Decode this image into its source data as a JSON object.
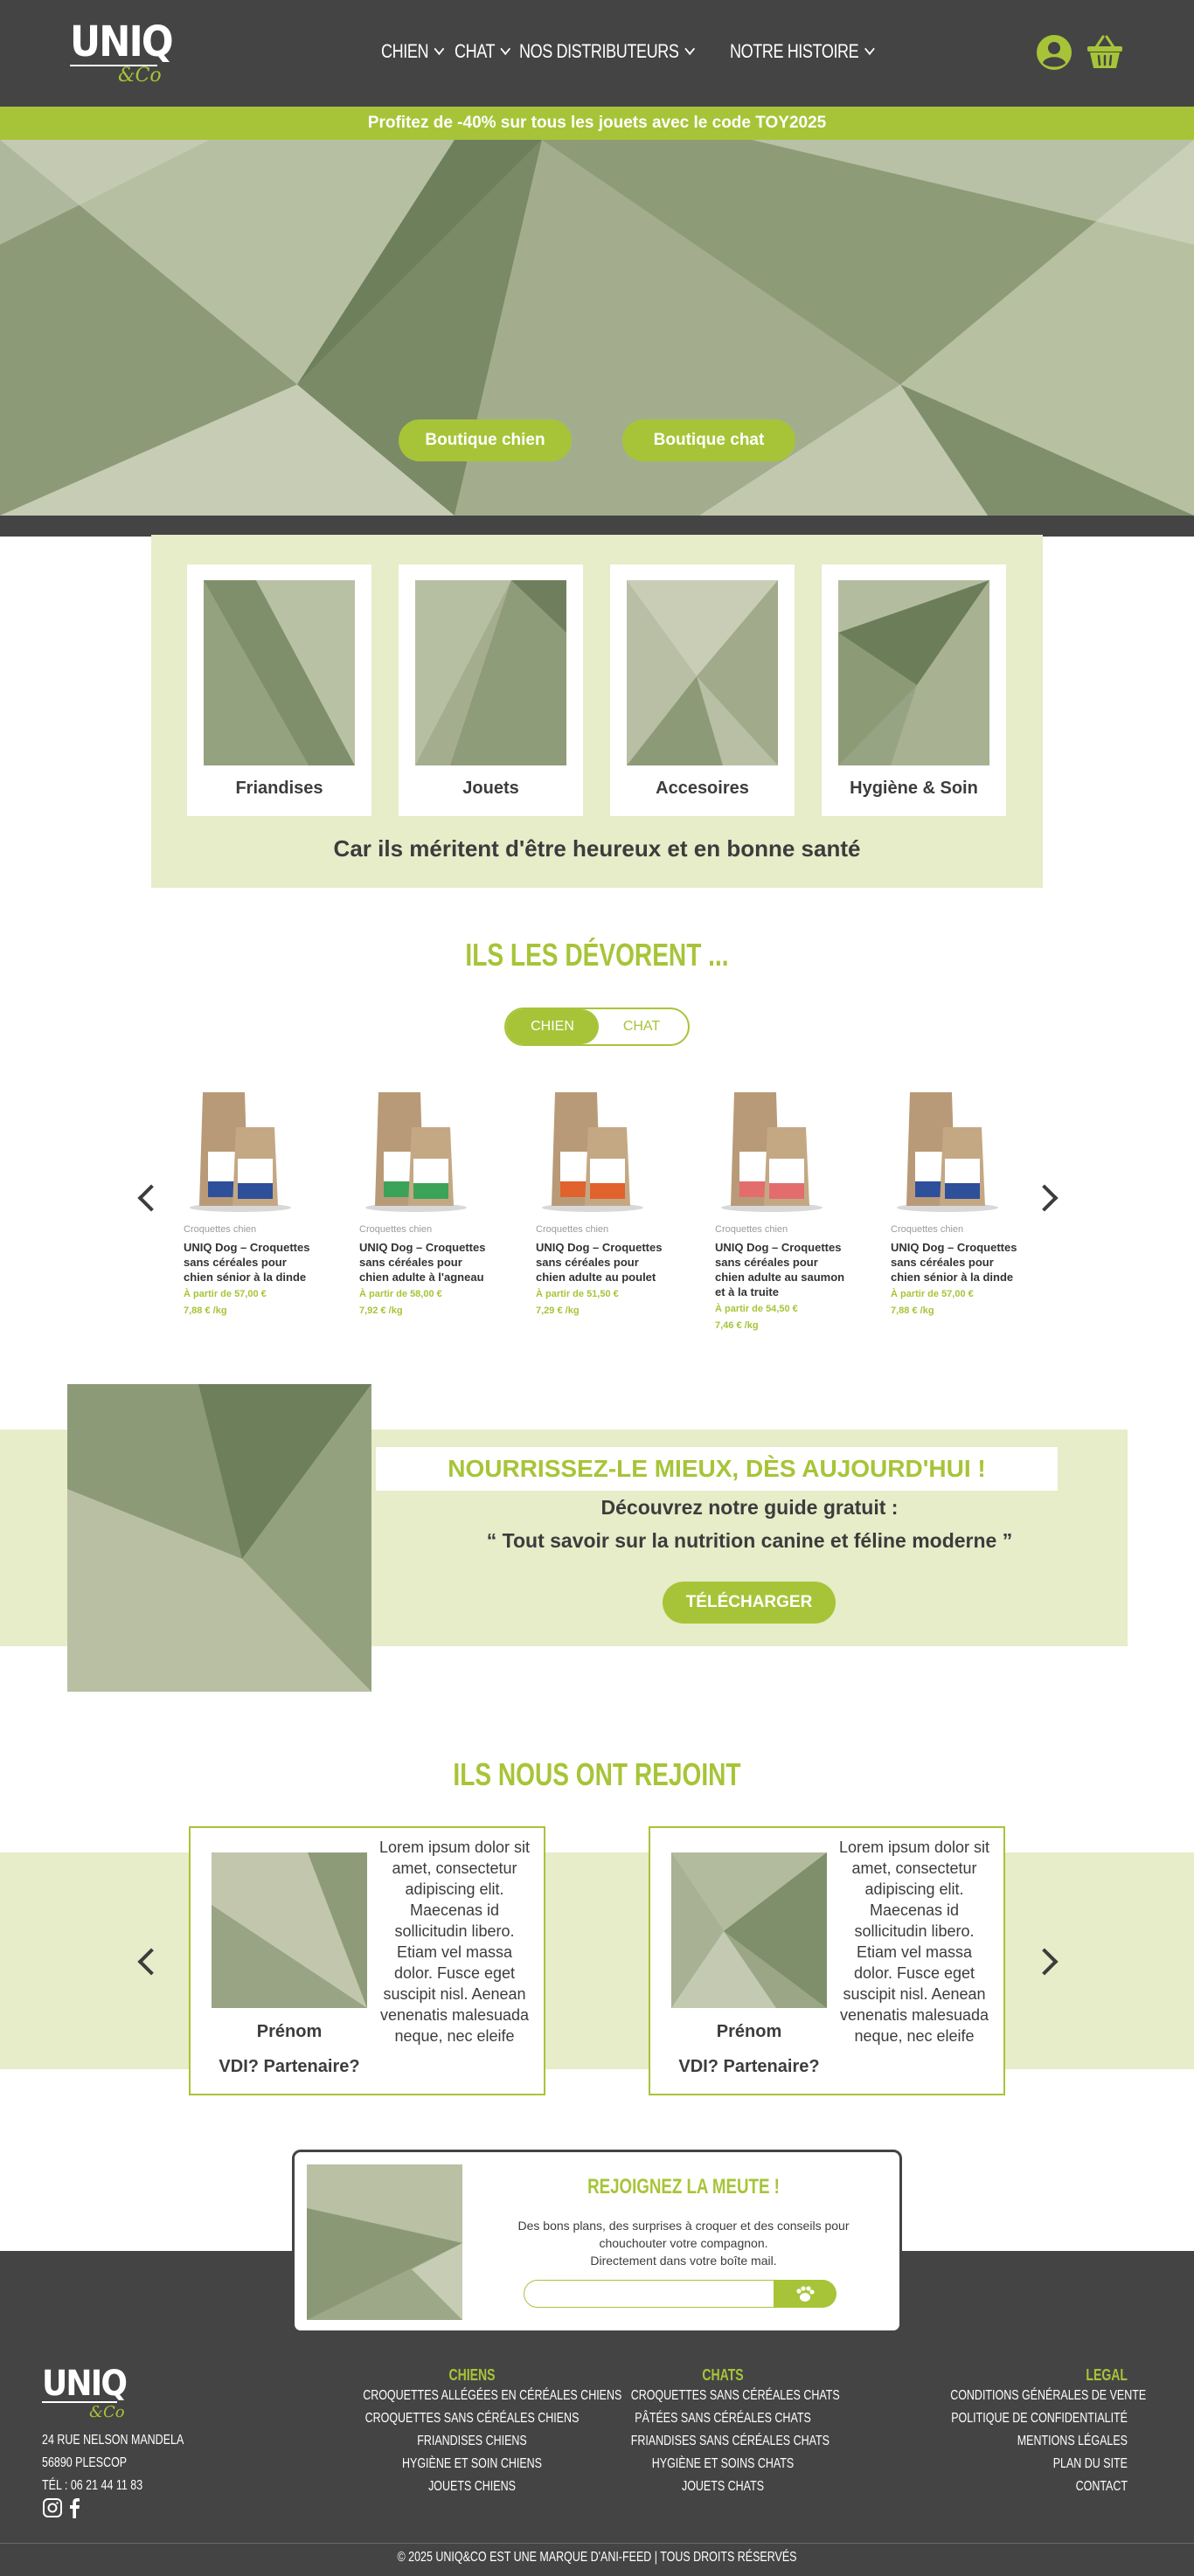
{
  "header": {
    "logo_main": "UNIQ",
    "logo_sub": "&Co",
    "nav": [
      {
        "label": "CHIEN"
      },
      {
        "label": "CHAT"
      },
      {
        "label": "NOS DISTRIBUTEURS"
      },
      {
        "label": "NOTRE HISTOIRE"
      }
    ],
    "icons": [
      "user-icon",
      "basket-icon"
    ]
  },
  "promo": {
    "text": "Profitez de -40% sur tous les jouets avec le code TOY2025"
  },
  "hero": {
    "btn_dog": "Boutique chien",
    "btn_cat": "Boutique chat"
  },
  "categories": {
    "items": [
      {
        "label": "Friandises"
      },
      {
        "label": "Jouets"
      },
      {
        "label": "Accesoires"
      },
      {
        "label": "Hygiène & Soin"
      }
    ],
    "tagline": "Car ils méritent d'être heureux et en bonne santé"
  },
  "devorent": {
    "title": "ILS LES DÉVORENT ...",
    "toggle_on": "CHIEN",
    "toggle_off": "CHAT",
    "products": [
      {
        "type": "Croquettes chien",
        "name": "UNIQ Dog – Croquettes sans céréales pour chien sénior à la dinde",
        "price": "À partir de 57,00 €",
        "unit": "7,88 € /kg",
        "accent": "#2e4f9a"
      },
      {
        "type": "Croquettes chien",
        "name": "UNIQ Dog – Croquettes sans céréales pour chien adulte à l'agneau",
        "price": "À partir de 58,00 €",
        "unit": "7,92 € /kg",
        "accent": "#3aa357"
      },
      {
        "type": "Croquettes chien",
        "name": "UNIQ Dog – Croquettes sans céréales pour chien adulte au poulet",
        "price": "À partir de 51,50 €",
        "unit": "7,29 € /kg",
        "accent": "#e0622c"
      },
      {
        "type": "Croquettes chien",
        "name": "UNIQ Dog – Croquettes sans céréales pour chien adulte au saumon et à la truite",
        "price": "À partir de 54,50 €",
        "unit": "7,46 € /kg",
        "accent": "#e36d6d"
      },
      {
        "type": "Croquettes chien",
        "name": "UNIQ Dog – Croquettes sans céréales pour chien sénior à la dinde",
        "price": "À partir de 57,00 €",
        "unit": "7,88 € /kg",
        "accent": "#2e4f9a"
      }
    ]
  },
  "guide": {
    "title": "NOURRISSEZ-LE MIEUX, DÈS AUJOURD'HUI !",
    "line1": "Découvrez notre guide gratuit :",
    "line2": "“ Tout savoir sur la nutrition canine et féline moderne ”",
    "button": "TÉLÉCHARGER"
  },
  "testimonials": {
    "title": "ILS NOUS ONT REJOINT",
    "cards": [
      {
        "name": "Prénom",
        "role": "VDI? Partenaire?",
        "text": "Lorem ipsum dolor sit amet, consectetur adipiscing elit. Maecenas id sollicitudin libero. Etiam vel massa dolor. Fusce eget suscipit nisl. Aenean venenatis malesuada neque, nec eleife"
      },
      {
        "name": "Prénom",
        "role": "VDI? Partenaire?",
        "text": "Lorem ipsum dolor sit amet, consectetur adipiscing elit. Maecenas id sollicitudin libero. Etiam vel massa dolor. Fusce eget suscipit nisl. Aenean venenatis malesuada neque, nec eleife"
      }
    ]
  },
  "newsletter": {
    "title": "REJOIGNEZ LA MEUTE !",
    "text1": "Des bons plans, des surprises à croquer et des conseils pour",
    "text2": "chouchouter votre compagnon.",
    "text3": "Directement dans votre boîte mail.",
    "input_value": "",
    "submit_icon": "paw-icon"
  },
  "footer": {
    "logo_main": "UNIQ",
    "logo_sub": "&Co",
    "address": [
      "24 RUE NELSON MANDELA",
      "56890 PLESCOP",
      "TÉL : 06 21 44 11 83"
    ],
    "social": [
      "instagram-icon",
      "facebook-icon"
    ],
    "chiens": {
      "title": "CHIENS",
      "items": [
        "CROQUETTES ALLÉGÉES EN CÉRÉALES CHIENS",
        "CROQUETTES SANS CÉRÉALES CHIENS",
        "FRIANDISES CHIENS",
        "HYGIÈNE ET SOIN CHIENS",
        "JOUETS CHIENS"
      ]
    },
    "chats": {
      "title": "CHATS",
      "items": [
        "CROQUETTES SANS CÉRÉALES CHATS",
        "PÂTÉES SANS CÉRÉALES CHATS",
        "FRIANDISES SANS CÉRÉALES CHATS",
        "HYGIÈNE ET SOINS CHATS",
        "JOUETS CHATS"
      ]
    },
    "legal": {
      "title": "LEGAL",
      "items": [
        "CONDITIONS GÉNÉRALES DE VENTE",
        "POLITIQUE DE CONFIDENTIALITÉ",
        "MENTIONS LÉGALES",
        "PLAN DU SITE",
        "CONTACT"
      ]
    },
    "copyright": "© 2025 UNIQ&CO EST UNE MARQUE D'ANI-FEED | TOUS DROITS RÉSERVÉS"
  },
  "colors": {
    "accent": "#a7c438",
    "dark": "#444444",
    "light_band": "#e7ecc9"
  }
}
